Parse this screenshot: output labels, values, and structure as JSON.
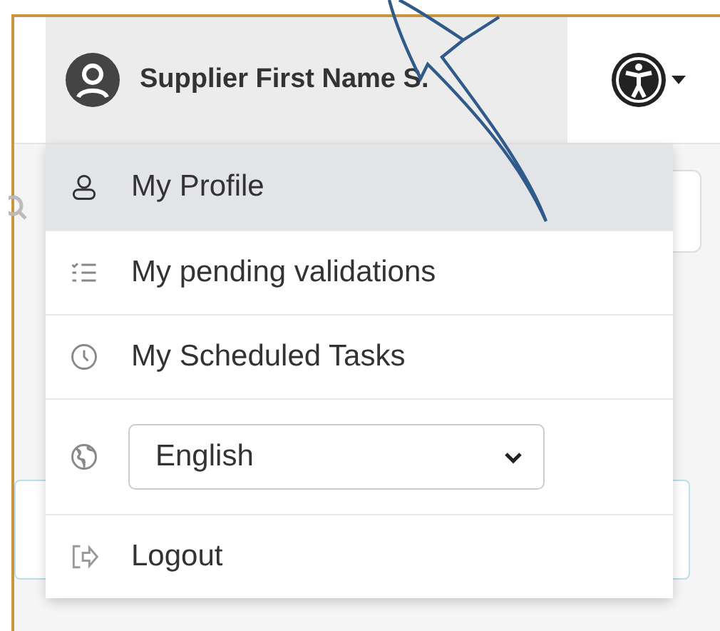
{
  "header": {
    "user_name": "Supplier First Name S.",
    "expanded": true
  },
  "user_menu": {
    "items": [
      {
        "kind": "link",
        "label": "My Profile",
        "selected": true
      },
      {
        "kind": "link",
        "label": "My pending validations",
        "selected": false
      },
      {
        "kind": "link",
        "label": "My Scheduled Tasks",
        "selected": false
      },
      {
        "kind": "select",
        "value": "English"
      },
      {
        "kind": "link",
        "label": "Logout",
        "selected": false
      }
    ]
  }
}
